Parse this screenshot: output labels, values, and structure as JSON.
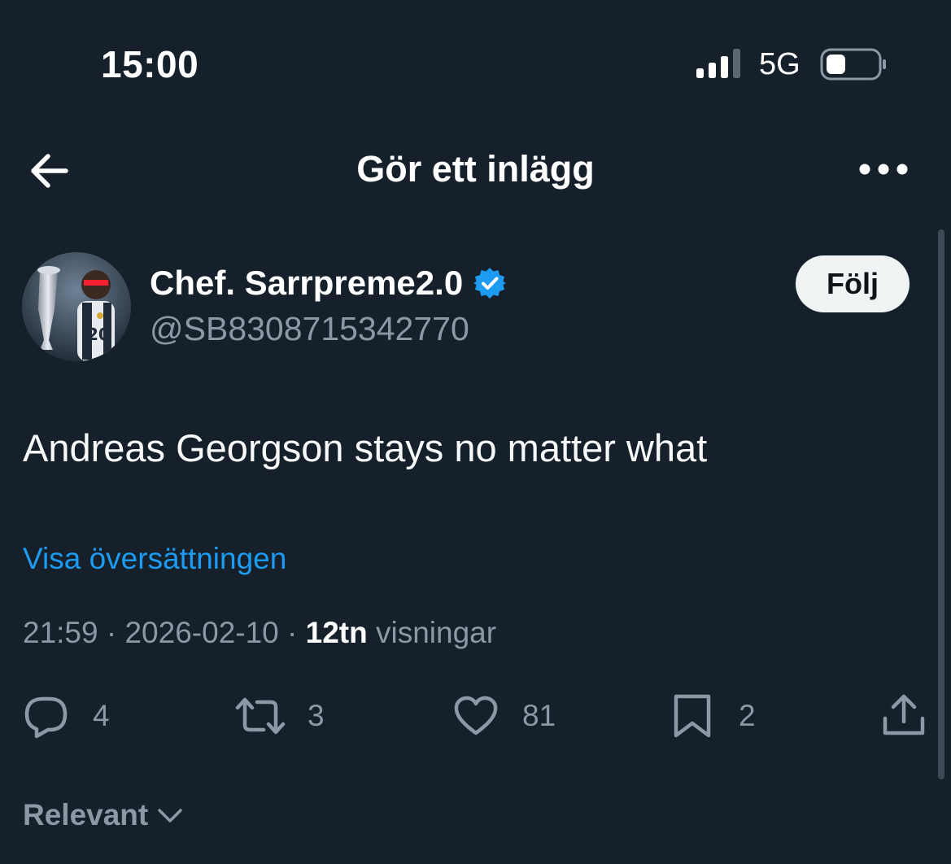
{
  "status_bar": {
    "time": "15:00",
    "network": "5G",
    "icons": [
      "signal-icon",
      "battery-icon"
    ]
  },
  "header": {
    "title": "Gör ett inlägg",
    "icons": [
      "back-arrow-icon",
      "more-options-icon"
    ]
  },
  "author": {
    "display_name": "Chef. Sarrpreme2.0",
    "handle": "@SB8308715342770",
    "verified": true,
    "follow_label": "Följ"
  },
  "tweet": {
    "text": "Andreas Georgson stays no matter what",
    "translate_label": "Visa översättningen",
    "time": "21:59",
    "date": "2026-02-10",
    "views_count": "12tn",
    "views_label": "visningar"
  },
  "actions": {
    "replies": "4",
    "reposts": "3",
    "likes": "81",
    "bookmarks": "2",
    "icons": [
      "reply-icon",
      "repost-icon",
      "like-icon",
      "bookmark-icon",
      "share-icon"
    ]
  },
  "sort": {
    "label": "Relevant"
  },
  "colors": {
    "background": "#15202b",
    "accent": "#1d9bf0",
    "muted": "#8b98a5",
    "text": "#ffffff"
  }
}
